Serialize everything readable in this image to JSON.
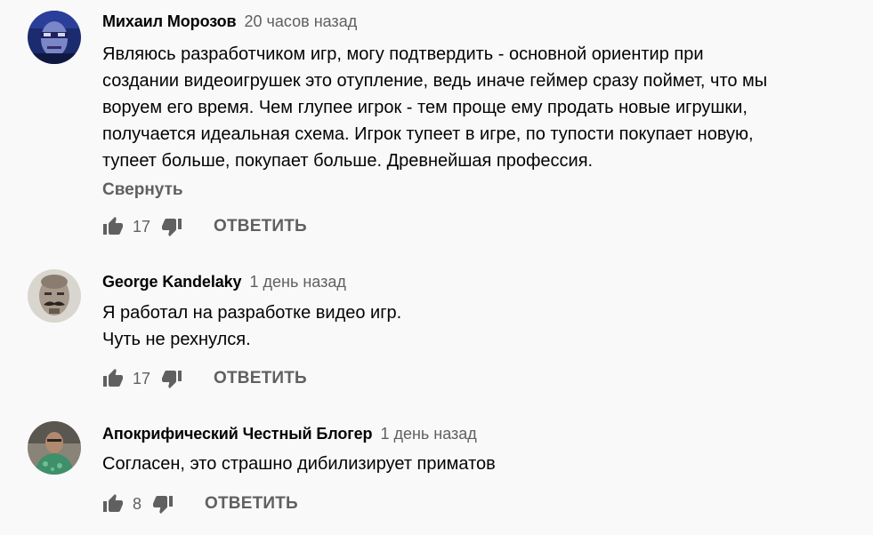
{
  "comments": [
    {
      "author": "Михаил Морозов",
      "time": "20 часов назад",
      "lines": [
        "Являюсь разработчиком игр, могу подтвердить - основной ориентир при",
        "создании видеоигрушек это отупление, ведь иначе геймер сразу поймет, что мы",
        "воруем его время. Чем глупее игрок - тем проще ему продать новые игрушки,",
        "получается идеальная схема. Игрок тупеет в игре, по тупости покупает новую,",
        "тупеет больше, покупает больше. Древнейшая профессия."
      ],
      "collapse_label": "Свернуть",
      "likes": "17",
      "reply_label": "ОТВЕТИТЬ"
    },
    {
      "author": "George Kandelaky",
      "time": "1 день назад",
      "lines": [
        "Я работал на разработке видео игр.",
        "Чуть не рехнулся."
      ],
      "likes": "17",
      "reply_label": "ОТВЕТИТЬ"
    },
    {
      "author": "Апокрифический Честный Блогер",
      "time": "1 день назад",
      "lines": [
        "Согласен, это страшно дибилизирует приматов"
      ],
      "likes": "8",
      "reply_label": "ОТВЕТИТЬ"
    }
  ],
  "colors": {
    "background": "#f9f9f9",
    "text": "#030303",
    "secondary": "#606060"
  }
}
